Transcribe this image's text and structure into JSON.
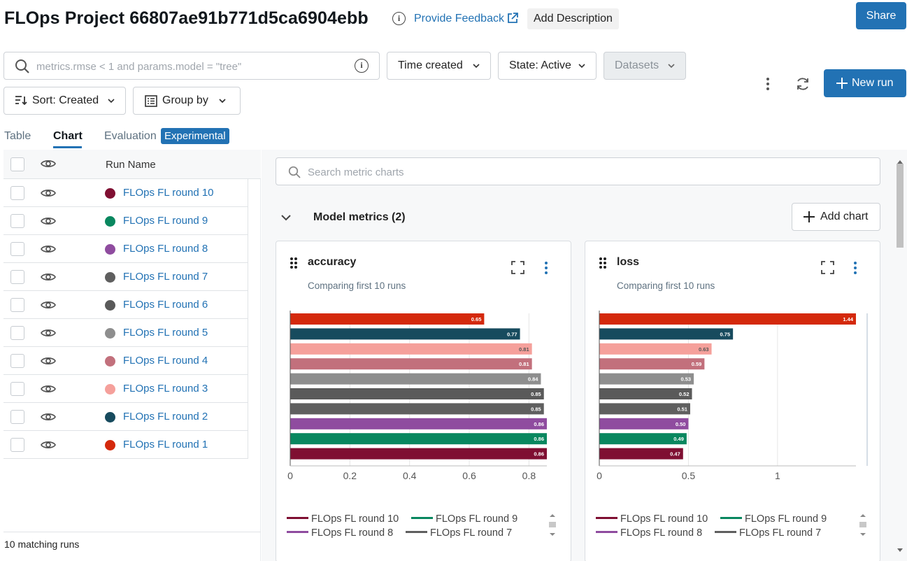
{
  "header": {
    "title": "FLOps Project 66807ae91b771d5ca6904ebb",
    "feedback_label": "Provide Feedback",
    "add_description_label": "Add Description",
    "share_label": "Share"
  },
  "filters": {
    "search_placeholder": "metrics.rmse < 1 and params.model = \"tree\"",
    "time_created_label": "Time created",
    "state_label": "State: Active",
    "datasets_label": "Datasets",
    "sort_label": "Sort: Created",
    "group_by_label": "Group by",
    "new_run_label": "New run"
  },
  "tabs": [
    {
      "label": "Table",
      "active": false
    },
    {
      "label": "Chart",
      "active": true
    },
    {
      "label": "Evaluation",
      "active": false
    }
  ],
  "experimental_badge": "Experimental",
  "runs_table": {
    "header_run_name": "Run Name",
    "rows": [
      {
        "name": "FLOps FL round 10",
        "color": "#7f0f32"
      },
      {
        "name": "FLOps FL round 9",
        "color": "#09875f"
      },
      {
        "name": "FLOps FL round 8",
        "color": "#8f4c9f"
      },
      {
        "name": "FLOps FL round 7",
        "color": "#5f5f5f"
      },
      {
        "name": "FLOps FL round 6",
        "color": "#5a5a5a"
      },
      {
        "name": "FLOps FL round 5",
        "color": "#8e8e8e"
      },
      {
        "name": "FLOps FL round 4",
        "color": "#c2707c"
      },
      {
        "name": "FLOps FL round 3",
        "color": "#f5a09b"
      },
      {
        "name": "FLOps FL round 2",
        "color": "#174b5e"
      },
      {
        "name": "FLOps FL round 1",
        "color": "#d4290c"
      }
    ],
    "matching_runs": "10 matching runs"
  },
  "charts_panel": {
    "search_placeholder": "Search metric charts",
    "section_title": "Model metrics (2)",
    "add_chart_label": "Add chart",
    "legend": [
      {
        "name": "FLOps FL round 10",
        "color": "#7f0f32"
      },
      {
        "name": "FLOps FL round 9",
        "color": "#09875f"
      },
      {
        "name": "FLOps FL round 8",
        "color": "#8f4c9f"
      },
      {
        "name": "FLOps FL round 7",
        "color": "#5f5f5f"
      }
    ]
  },
  "chart_data": [
    {
      "type": "bar",
      "orientation": "horizontal",
      "title": "accuracy",
      "subtitle": "Comparing first 10 runs",
      "categories": [
        "FLOps FL round 1",
        "FLOps FL round 2",
        "FLOps FL round 3",
        "FLOps FL round 4",
        "FLOps FL round 5",
        "FLOps FL round 6",
        "FLOps FL round 7",
        "FLOps FL round 8",
        "FLOps FL round 9",
        "FLOps FL round 10"
      ],
      "values": [
        0.65,
        0.77,
        0.81,
        0.81,
        0.84,
        0.85,
        0.85,
        0.86,
        0.86,
        0.86
      ],
      "value_labels": [
        "0.65",
        "0.77",
        "0.81",
        "0.81",
        "0.84",
        "0.85",
        "0.85",
        "0.86",
        "0.86",
        "0.86"
      ],
      "colors": [
        "#d4290c",
        "#174b5e",
        "#f5a09b",
        "#c2707c",
        "#8e8e8e",
        "#5a5a5a",
        "#5f5f5f",
        "#8f4c9f",
        "#09875f",
        "#7f0f32"
      ],
      "xticks": [
        "0",
        "0.2",
        "0.4",
        "0.6",
        "0.8"
      ],
      "xlim": [
        0,
        0.86
      ],
      "grid": true
    },
    {
      "type": "bar",
      "orientation": "horizontal",
      "title": "loss",
      "subtitle": "Comparing first 10 runs",
      "categories": [
        "FLOps FL round 1",
        "FLOps FL round 2",
        "FLOps FL round 3",
        "FLOps FL round 4",
        "FLOps FL round 5",
        "FLOps FL round 6",
        "FLOps FL round 7",
        "FLOps FL round 8",
        "FLOps FL round 9",
        "FLOps FL round 10"
      ],
      "values": [
        1.44,
        0.75,
        0.63,
        0.59,
        0.53,
        0.52,
        0.51,
        0.5,
        0.49,
        0.47
      ],
      "value_labels": [
        "1.44",
        "0.75",
        "0.63",
        "0.59",
        "0.53",
        "0.52",
        "0.51",
        "0.50",
        "0.49",
        "0.47"
      ],
      "colors": [
        "#d4290c",
        "#174b5e",
        "#f5a09b",
        "#c2707c",
        "#8e8e8e",
        "#5a5a5a",
        "#5f5f5f",
        "#8f4c9f",
        "#09875f",
        "#7f0f32"
      ],
      "xticks": [
        "0",
        "0.5",
        "1"
      ],
      "xlim": [
        0,
        1.44
      ],
      "grid": true
    }
  ]
}
